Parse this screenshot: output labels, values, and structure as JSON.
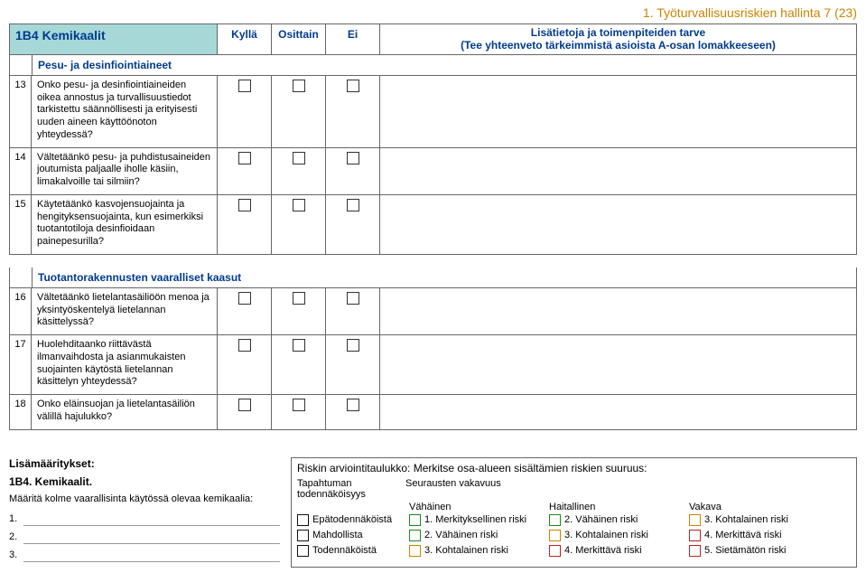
{
  "page_header": "1. Työturvallisuusriskien hallinta 7 (23)",
  "section_code": "1B4",
  "section_name": "Kemikaalit",
  "cols": {
    "yes": "Kyllä",
    "partly": "Osittain",
    "no": "Ei"
  },
  "details_title": "Lisätietoja ja toimenpiteiden tarve",
  "details_sub": "(Tee yhteenveto tärkeimmistä asioista A-osan lomakkeeseen)",
  "group1": "Pesu- ja desinfiointiaineet",
  "group2": "Tuotantorakennusten vaaralliset kaasut",
  "questions1": [
    {
      "n": "13",
      "t": "Onko pesu- ja desinfiointiaineiden oikea annostus ja turvallisuustiedot tarkistettu säännöllisesti ja erityisesti uuden aineen käyttöönoton yhteydessä?"
    },
    {
      "n": "14",
      "t": "Vältetäänkö pesu- ja puhdistusaineiden joutumista paljaalle iholle käsiin, limakalvoille tai silmiin?"
    },
    {
      "n": "15",
      "t": "Käytetäänkö kasvojensuojainta ja hengityksensuojainta, kun esimerkiksi tuotantotiloja desinfioidaan painepesurilla?"
    }
  ],
  "questions2": [
    {
      "n": "16",
      "t": "Vältetäänkö lietelantasäiliöön menoa ja yksintyöskentelyä lietelannan käsittelyssä?"
    },
    {
      "n": "17",
      "t": "Huolehditaanko riittävästä ilmanvaihdosta ja asianmukaisten suojainten käytöstä lietelannan käsittelyn yhteydessä?"
    },
    {
      "n": "18",
      "t": "Onko eläinsuojan ja lietelantasäiliön välillä hajulukko?"
    }
  ],
  "extra": {
    "title": "Lisämääritykset:",
    "sub": "1B4. Kemikaalit.",
    "line": "Määritä kolme vaarallisinta käytössä olevaa kemikaalia:",
    "nums": [
      "1.",
      "2.",
      "3."
    ]
  },
  "risk": {
    "title": "Riskin arviointitaulukko: Merkitse osa-alueen sisältämien riskien suuruus:",
    "prob_h": "Tapahtuman todennäköisyys",
    "cons_h": "Seurausten vakavuus",
    "sev": [
      "Vähäinen",
      "Haitallinen",
      "Vakava"
    ],
    "rows": [
      {
        "p": "Epätodennäköistä",
        "c": [
          "1. Merkityksellinen riski",
          "2. Vähäinen riski",
          "3. Kohtalainen riski"
        ],
        "cls": [
          "c-green",
          "c-green",
          "c-yellow"
        ]
      },
      {
        "p": "Mahdollista",
        "c": [
          "2. Vähäinen riski",
          "3. Kohtalainen riski",
          "4. Merkittävä riski"
        ],
        "cls": [
          "c-green",
          "c-yellow",
          "c-red"
        ]
      },
      {
        "p": "Todennäköistä",
        "c": [
          "3. Kohtalainen riski",
          "4. Merkittävä riski",
          "5. Sietämätön riski"
        ],
        "cls": [
          "c-yellow",
          "c-red",
          "c-red"
        ]
      }
    ]
  }
}
